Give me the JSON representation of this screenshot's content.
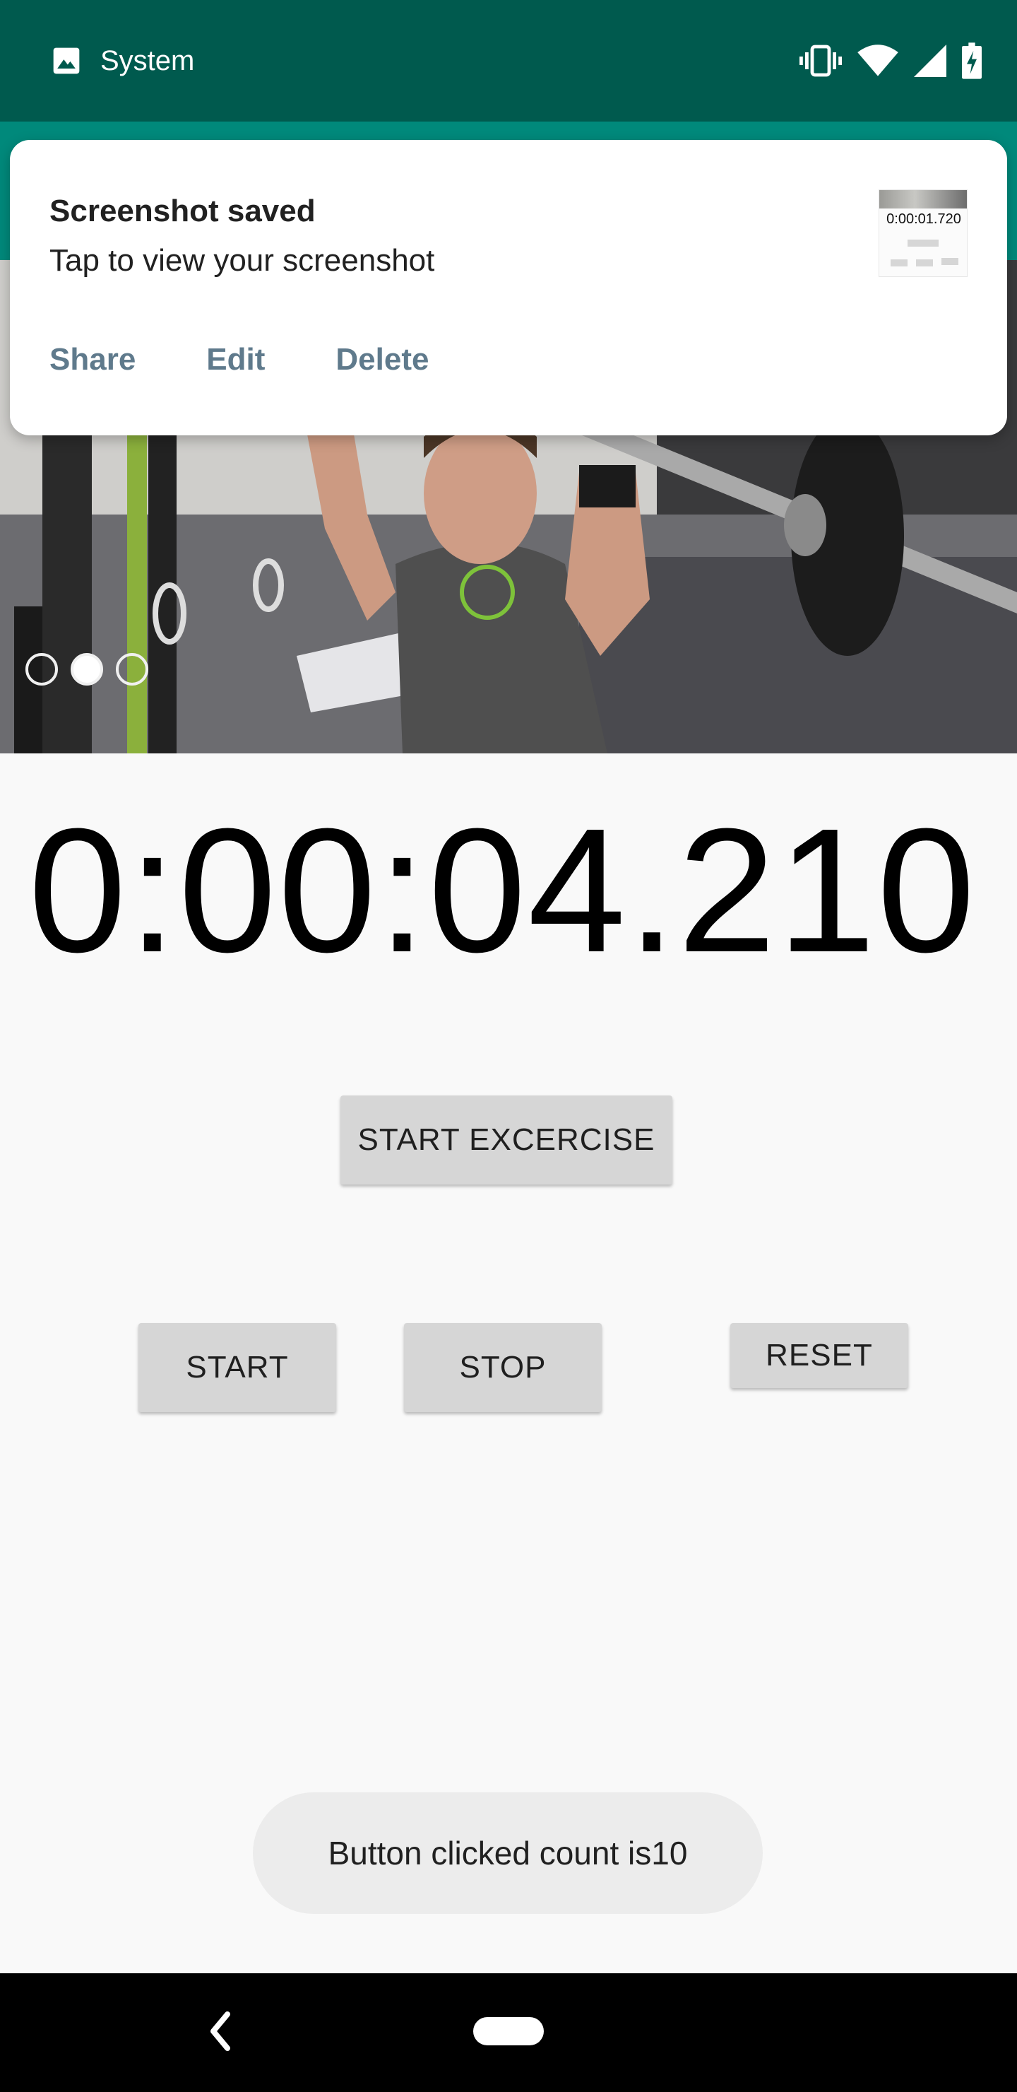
{
  "status_bar": {
    "app_label": "System",
    "image_icon": "image-icon",
    "vibrate_icon": "vibrate-icon",
    "wifi_icon": "wifi-icon",
    "signal_icon": "cell-signal-icon",
    "battery_icon": "battery-icon"
  },
  "notification": {
    "title": "Screenshot saved",
    "text": "Tap to view your screenshot",
    "actions": [
      "Share",
      "Edit",
      "Delete"
    ],
    "thumbnail_time": "0:00:01.720"
  },
  "carousel": {
    "page_count": 3,
    "active_index": 1
  },
  "stopwatch": {
    "time": "0:00:04.210"
  },
  "buttons": {
    "start_exercise": "START EXCERCISE",
    "start": "START",
    "stop": "STOP",
    "reset": "RESET"
  },
  "toast": {
    "text": "Button clicked count is10"
  },
  "colors": {
    "status_bar": "#005a4e",
    "app_bar": "#00897b",
    "button_bg": "#d6d6d6",
    "background": "#f9f9f9",
    "notification_action": "#5f7a8c"
  }
}
